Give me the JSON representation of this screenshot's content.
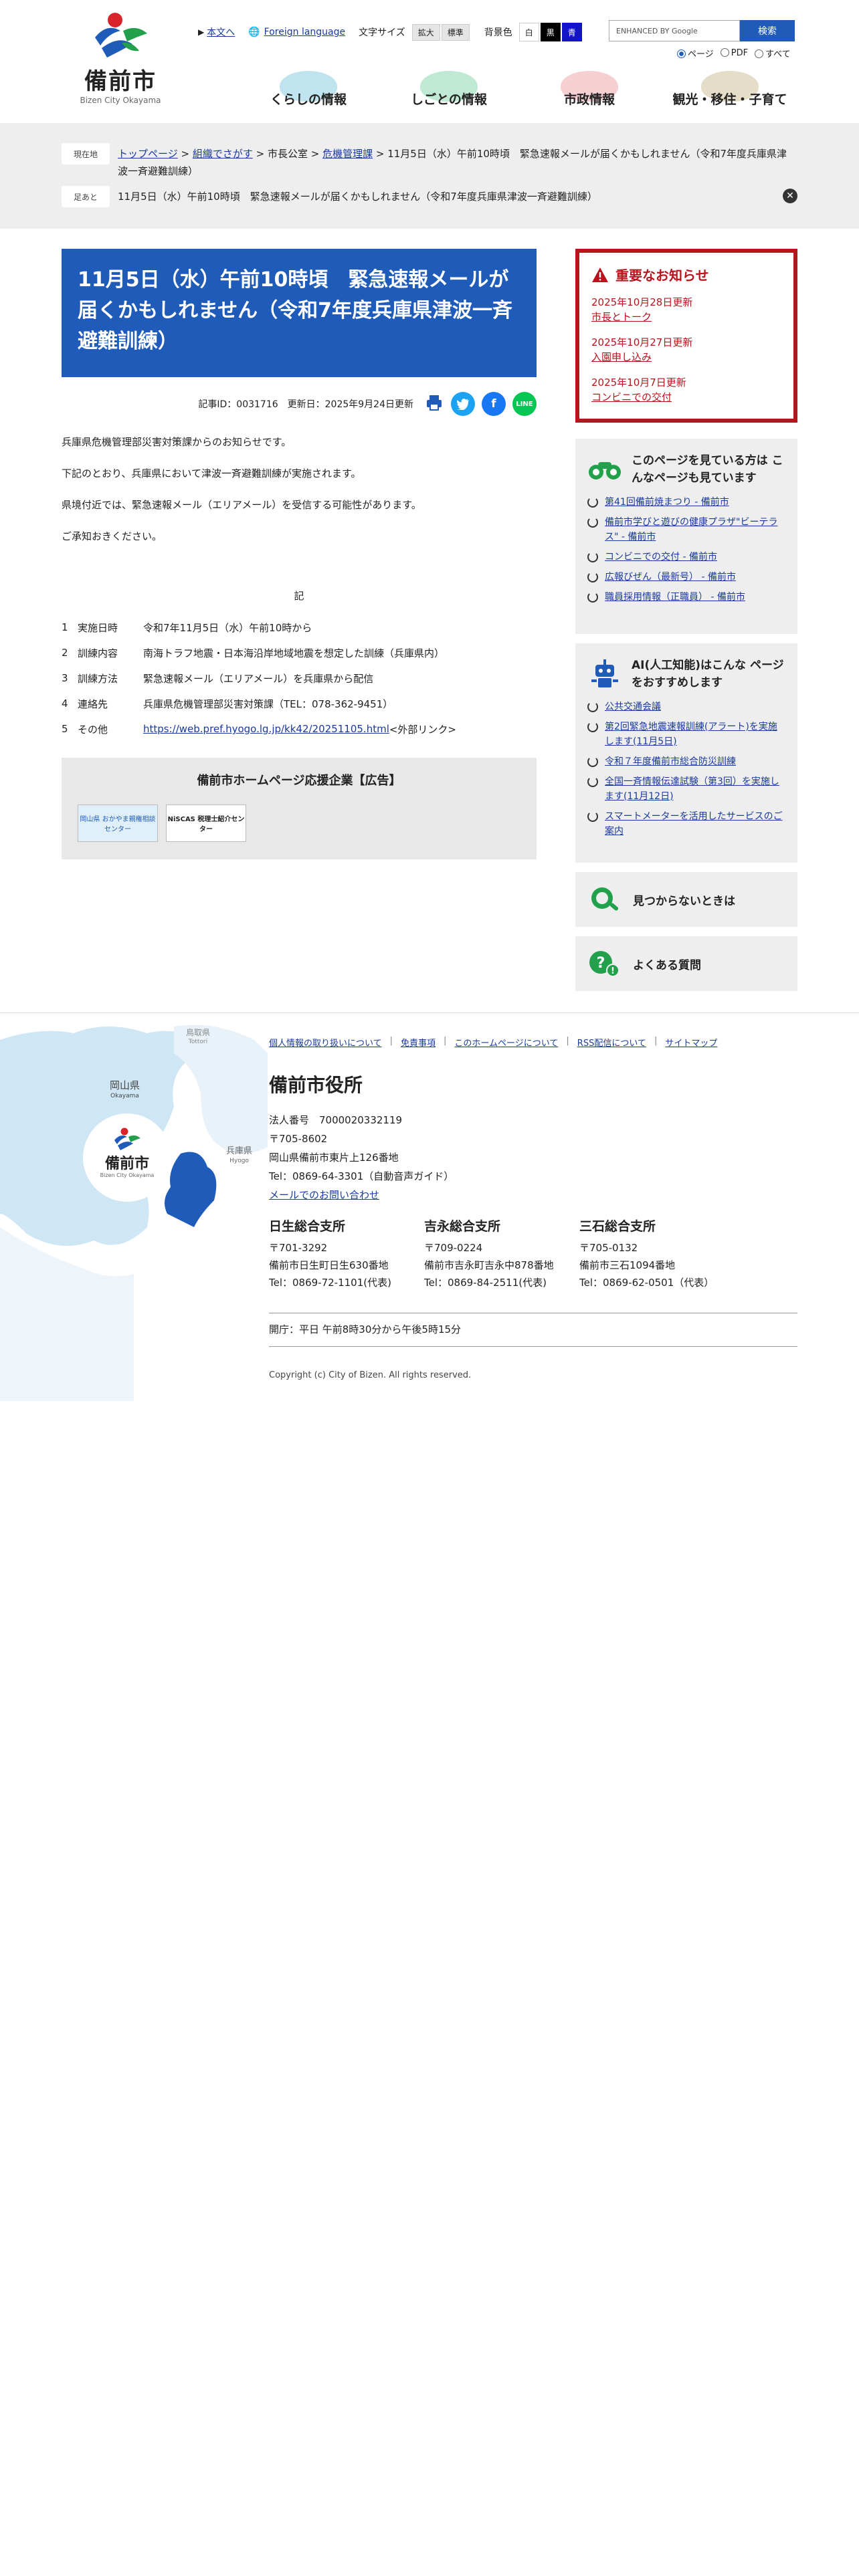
{
  "header": {
    "logo_title": "備前市",
    "logo_sub": "Bizen City Okayama",
    "util": {
      "honbun": "本文へ",
      "foreign": "Foreign language",
      "font_size_label": "文字サイズ",
      "font_large": "拡大",
      "font_normal": "標準",
      "bg_label": "背景色",
      "bg_white": "白",
      "bg_black": "黒",
      "bg_blue": "青"
    },
    "search": {
      "placeholder": "ENHANCED BY Google",
      "button": "検索",
      "scopes": [
        "ページ",
        "PDF",
        "すべて"
      ]
    },
    "nav": [
      "くらしの情報",
      "しごとの情報",
      "市政情報",
      "観光・移住・子育て"
    ]
  },
  "breadcrumb": {
    "current_label": "現在地",
    "links": [
      "トップページ",
      "組織でさがす"
    ],
    "plain": "市長公室",
    "link3": "危機管理課",
    "current": "11月5日（水）午前10時頃　緊急速報メールが届くかもしれません（令和7年度兵庫県津波一斉避難訓練）",
    "history_label": "足あと",
    "history": "11月5日（水）午前10時頃　緊急速報メールが届くかもしれません（令和7年度兵庫県津波一斉避難訓練）"
  },
  "article": {
    "title": "11月5日（水）午前10時頃　緊急速報メールが届くかもしれません（令和7年度兵庫県津波一斉避難訓練）",
    "meta": "記事ID：0031716　更新日：2025年9月24日更新",
    "paras": [
      "兵庫県危機管理部災害対策課からのお知らせです。",
      "下記のとおり、兵庫県において津波一斉避難訓練が実施されます。",
      "県境付近では、緊急速報メール（エリアメール）を受信する可能性があります。",
      "ご承知おきください。"
    ],
    "ki": "記",
    "items": [
      {
        "n": "1",
        "k": "実施日時",
        "v": "令和7年11月5日（水）午前10時から"
      },
      {
        "n": "2",
        "k": "訓練内容",
        "v": "南海トラフ地震・日本海沿岸地域地震を想定した訓練（兵庫県内）"
      },
      {
        "n": "3",
        "k": "訓練方法",
        "v": "緊急速報メール（エリアメール）を兵庫県から配信"
      },
      {
        "n": "4",
        "k": "連絡先",
        "v": "兵庫県危機管理部災害対策課（TEL：078-362-9451）"
      }
    ],
    "item5": {
      "n": "5",
      "k": "その他",
      "link": "https://web.pref.hyogo.lg.jp/kk42/20251105.html",
      "suffix": "<外部リンク>"
    },
    "ad_title": "備前市ホームページ応援企業【広告】",
    "banners": [
      "岡山県 おかやま親権相談センター",
      "NiSCAS 税理士紹介センター"
    ]
  },
  "sidebar": {
    "notice_title": "重要なお知らせ",
    "notices": [
      {
        "date": "2025年10月28日更新",
        "text": "市長とトーク"
      },
      {
        "date": "2025年10月27日更新",
        "text": "入園申し込み"
      },
      {
        "date": "2025年10月7日更新",
        "text": "コンビニでの交付"
      }
    ],
    "also_title": "このページを見ている方は こんなページも見ています",
    "also": [
      "第41回備前焼まつり - 備前市",
      "備前市学びと遊びの健康プラザ\"ビーテラス\" - 備前市",
      "コンビニでの交付 - 備前市",
      "広報びぜん（最新号） - 備前市",
      "職員採用情報（正職員） - 備前市"
    ],
    "ai_title": "AI(人工知能)はこんな ページをおすすめします",
    "ai": [
      "公共交通会議",
      "第2回緊急地震速報訓練(アラート)を実施します(11月5日)",
      "令和７年度備前市総合防災訓練",
      "全国一斉情報伝達試験（第3回）を実施します(11月12日)",
      "スマートメーターを活用したサービスのご案内"
    ],
    "notfound": "見つからないときは",
    "faq": "よくある質問"
  },
  "footer": {
    "map": {
      "pref": "岡山県",
      "pref_en": "Okayama",
      "tottori": "鳥取県",
      "tottori_en": "Tottori",
      "hyogo": "兵庫県",
      "hyogo_en": "Hyogo",
      "logo": "備前市",
      "logo_en": "Bizen City Okayama"
    },
    "links": [
      "個人情報の取り扱いについて",
      "免責事項",
      "このホームページについて",
      "RSS配信について",
      "サイトマップ"
    ],
    "name": "備前市役所",
    "corp": "法人番号　7000020332119",
    "zip": "〒705-8602",
    "addr": "岡山県備前市東片上126番地",
    "tel": "Tel：0869-64-3301（自動音声ガイド）",
    "mail": "メールでのお問い合わせ",
    "branches": [
      {
        "name": "日生総合支所",
        "zip": "〒701-3292",
        "addr": "備前市日生町日生630番地",
        "tel": "Tel：0869-72-1101(代表)"
      },
      {
        "name": "吉永総合支所",
        "zip": "〒709-0224",
        "addr": "備前市吉永町吉永中878番地",
        "tel": "Tel：0869-84-2511(代表)"
      },
      {
        "name": "三石総合支所",
        "zip": "〒705-0132",
        "addr": "備前市三石1094番地",
        "tel": "Tel：0869-62-0501（代表）"
      }
    ],
    "hours": "開庁：平日 午前8時30分から午後5時15分",
    "copyright": "Copyright (c) City of Bizen. All rights reserved."
  }
}
